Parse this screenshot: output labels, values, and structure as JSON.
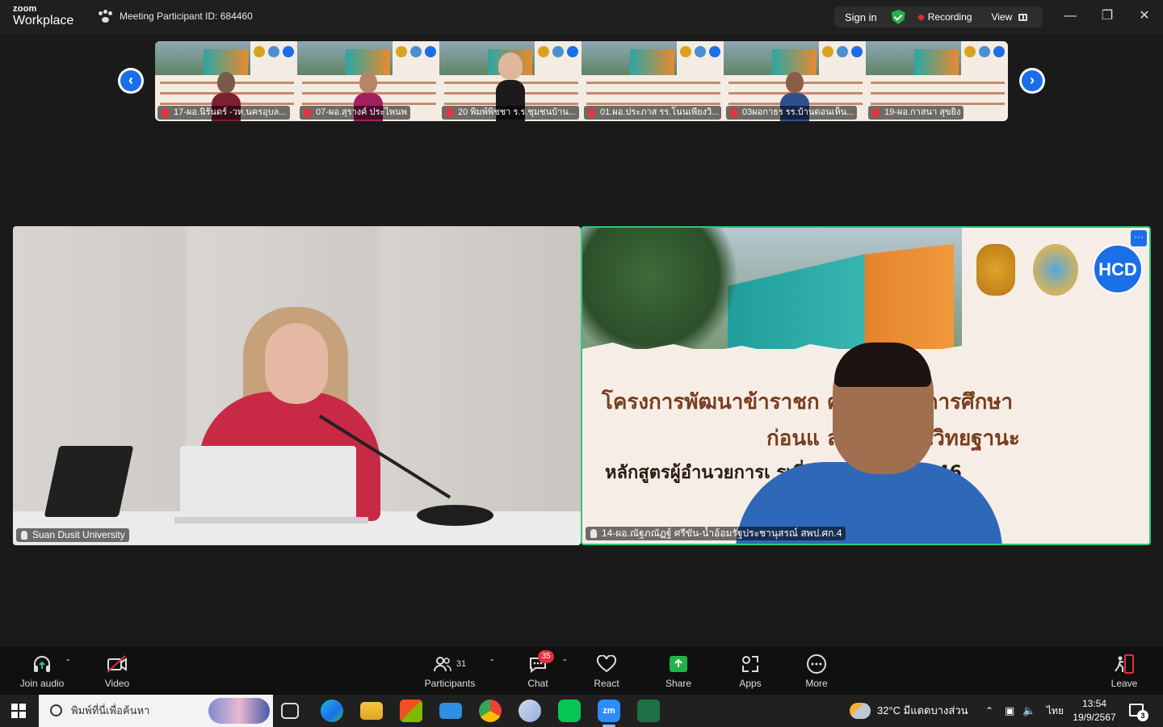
{
  "window": {
    "brand_small": "zoom",
    "brand_large": "Workplace",
    "meeting_id_label": "Meeting Participant ID: 684460",
    "sign_in": "Sign in",
    "recording": "Recording",
    "view": "View"
  },
  "gallery": {
    "tiles": [
      {
        "name": "17-ผอ.นิรันดร์ -วท.นครอุบล..."
      },
      {
        "name": "07-ผอ.สุรางค์ ประไพนพ"
      },
      {
        "name": "20 พิมพ์พิชชา ร.ร.ชุมชนบ้าน..."
      },
      {
        "name": "01.ผอ.ประภาส รร.โนนเพียงวิ..."
      },
      {
        "name": "03ผอกาธร รร.บ้านดอนเห็น..."
      },
      {
        "name": "19-ผอ.กาสนา สุขยิง"
      }
    ]
  },
  "main": {
    "left_name": "Suan Dusit University",
    "right_name": "14-ผอ.ณัฐภณัฏฐ์ ศรีขัน-น้ำอ้อมรัฐประชานุสรณ์ สพป.ศก.4",
    "slide_line1": "โครงการพัฒนาข้าราชก คลากรทางการศึกษา",
    "slide_line2": "ก่อนแ ละเลื่อนเป็นวิทยฐานะ",
    "slide_line3": "หลักสูตรผู้อำนวยการเ รเชี่ยวชาญ ระยะที่ 146",
    "slide_logo_text": "HCD",
    "more_label": "···"
  },
  "toolbar": {
    "join_audio": "Join audio",
    "video": "Video",
    "participants": "Participants",
    "participants_count": "31",
    "chat": "Chat",
    "chat_badge": "35",
    "react": "React",
    "share": "Share",
    "apps": "Apps",
    "more": "More",
    "leave": "Leave"
  },
  "taskbar": {
    "search_placeholder": "พิมพ์ที่นี่เพื่อค้นหา",
    "weather": "32°C  มีแดดบางส่วน",
    "lang": "ไทย",
    "time": "13:54",
    "date": "19/9/2567",
    "notif_count": "3",
    "zoom_app": "zm"
  },
  "colors": {
    "accent_blue": "#1a6fe8",
    "active_speaker": "#2ec879",
    "recording_red": "#e0303a"
  }
}
